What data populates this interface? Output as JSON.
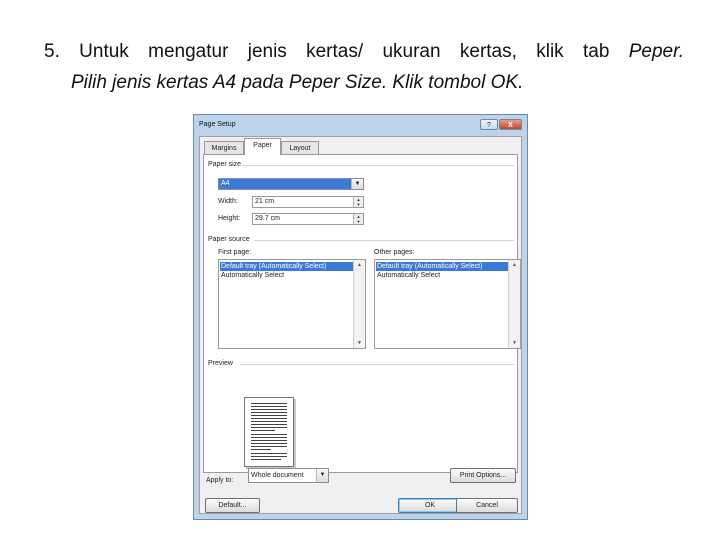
{
  "instruction": {
    "number": "5.",
    "words": [
      "Untuk",
      "mengatur",
      "jenis",
      "kertas/",
      "ukuran",
      "kertas,",
      "klik",
      "tab",
      "Peper."
    ],
    "line2": "Pilih jenis kertas A4 pada Peper Size. Klik tombol OK."
  },
  "dialog": {
    "title": "Page Setup",
    "help_label": "?",
    "close_label": "X",
    "tabs": [
      "Margins",
      "Paper",
      "Layout"
    ],
    "paper_size": {
      "label": "Paper size",
      "value": "A4",
      "width_label": "Width:",
      "width_value": "21 cm",
      "height_label": "Height:",
      "height_value": "29.7 cm"
    },
    "paper_source": {
      "label": "Paper source",
      "first_page_label": "First page:",
      "other_pages_label": "Other pages:",
      "first_page_items": [
        "Default tray (Automatically Select)",
        "Automatically Select"
      ],
      "other_pages_items": [
        "Default tray (Automatically Select)",
        "Automatically Select"
      ]
    },
    "preview_label": "Preview",
    "apply_to_label": "Apply to:",
    "apply_to_value": "Whole document",
    "print_options_label": "Print Options...",
    "default_label": "Default...",
    "ok_label": "OK",
    "cancel_label": "Cancel"
  }
}
